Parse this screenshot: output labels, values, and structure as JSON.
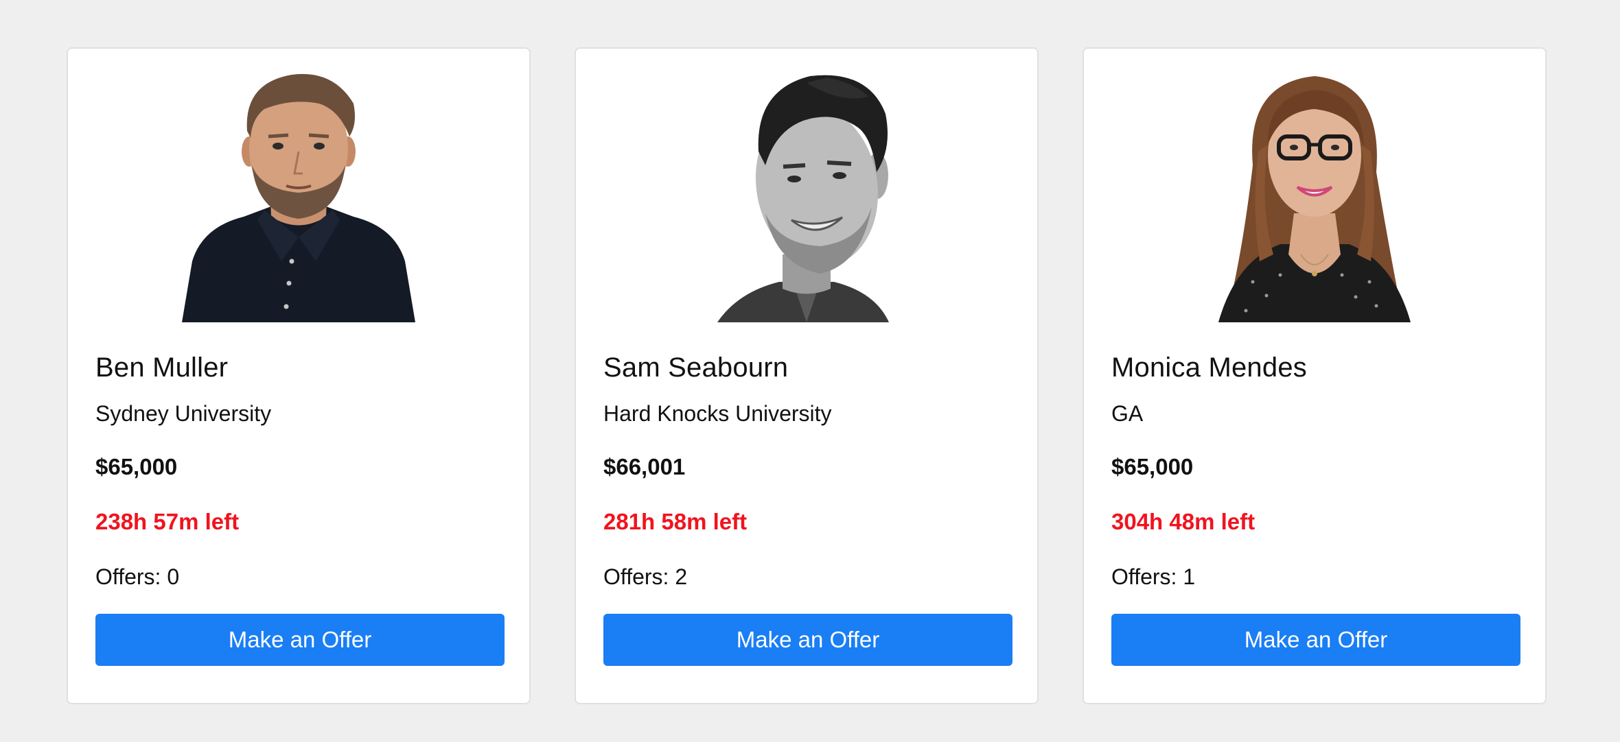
{
  "candidates": [
    {
      "name": "Ben Muller",
      "school": "Sydney University",
      "salary": "$65,000",
      "time_left": "238h 57m left",
      "offers": "Offers: 0",
      "button_label": "Make an Offer"
    },
    {
      "name": "Sam Seabourn",
      "school": "Hard Knocks University",
      "salary": "$66,001",
      "time_left": "281h 58m left",
      "offers": "Offers: 2",
      "button_label": "Make an Offer"
    },
    {
      "name": "Monica Mendes",
      "school": "GA",
      "salary": "$65,000",
      "time_left": "304h 48m left",
      "offers": "Offers: 1",
      "button_label": "Make an Offer"
    }
  ],
  "colors": {
    "accent": "#1a7ef5",
    "time_left": "#f0141e",
    "background": "#efefef"
  }
}
